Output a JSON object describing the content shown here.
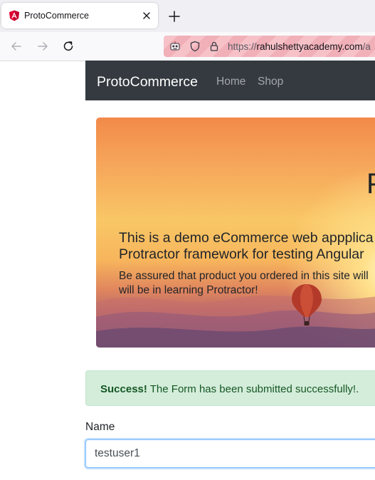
{
  "browser": {
    "tab": {
      "title": "ProtoCommerce",
      "favicon": "angular-logo-icon"
    },
    "url": {
      "scheme": "https://",
      "host": "rahulshettyacademy.com",
      "path": "/a"
    }
  },
  "site": {
    "brand": "ProtoCommerce",
    "nav": [
      {
        "label": "Home"
      },
      {
        "label": "Shop"
      }
    ]
  },
  "jumbotron": {
    "title": "P",
    "lead_line1": "This is a demo eCommerce web appplica",
    "lead_line2": "Protractor framework for testing Angular",
    "sub_line1": "Be assured that product you ordered in this site will",
    "sub_line2": "will be in learning Protractor!"
  },
  "alert": {
    "strong": "Success!",
    "message": " The Form has been submitted successfully!."
  },
  "form": {
    "name_label": "Name",
    "name_value": "testuser1"
  },
  "colors": {
    "navbar_bg": "#343a40",
    "alert_bg": "#d4edda",
    "alert_text": "#155724",
    "input_focus_border": "#80bdff"
  }
}
